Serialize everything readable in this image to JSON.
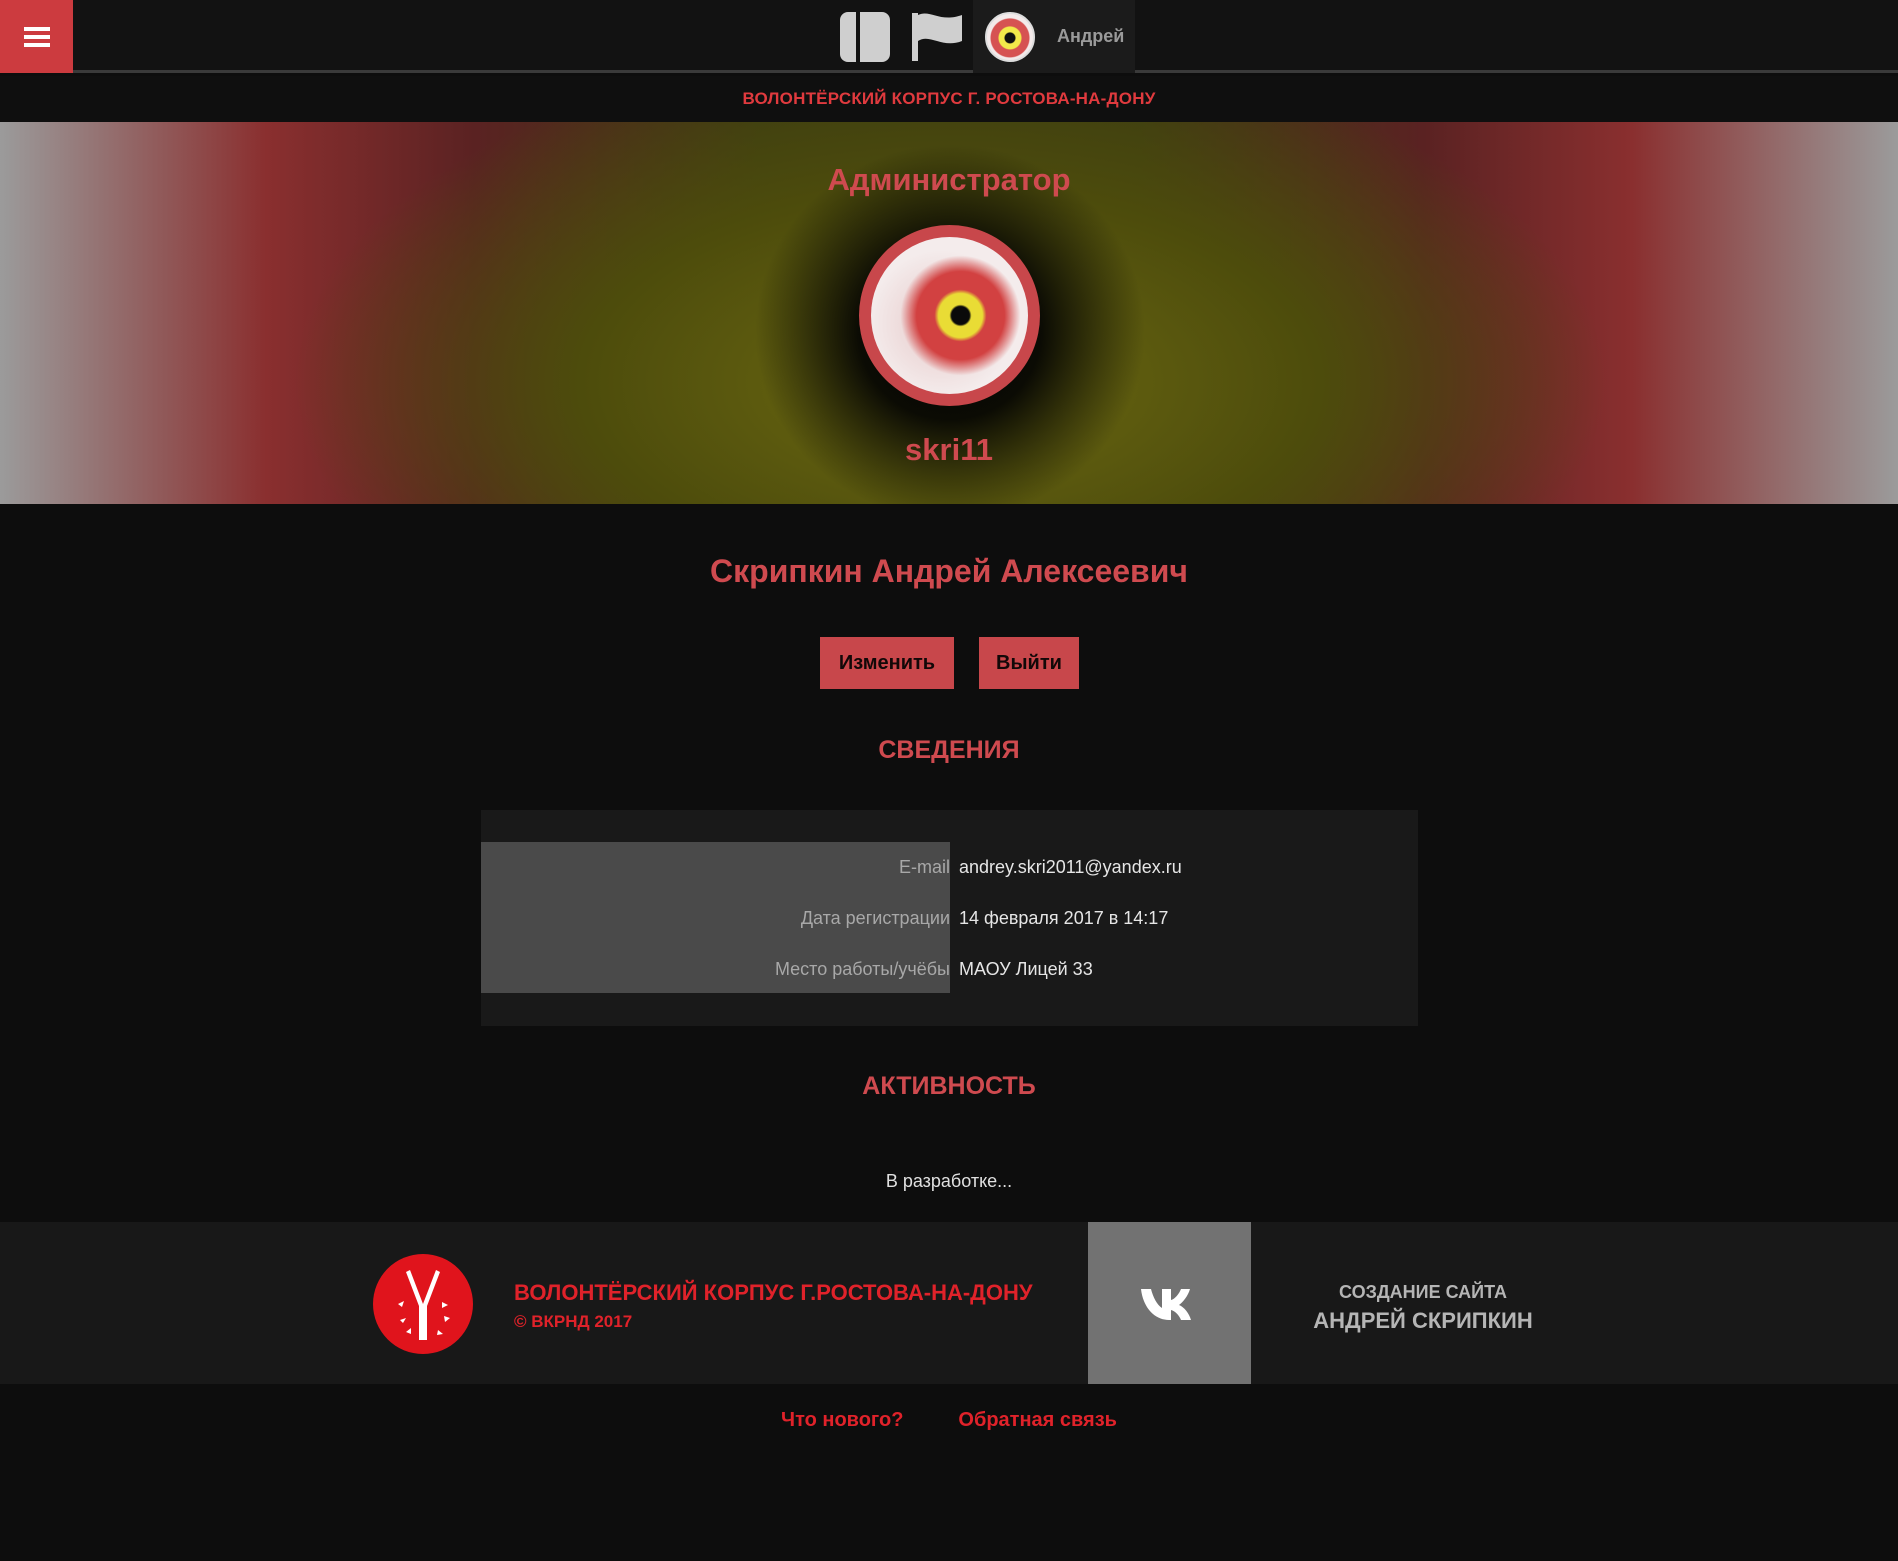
{
  "header": {
    "menu_icon": "hamburger-icon",
    "nav_icons": [
      "layout-icon",
      "flag-icon"
    ],
    "user_name": "Андрей",
    "accent_color": "#cc3b3f"
  },
  "org_bar": {
    "title": "ВОЛОНТЁРСКИЙ КОРПУС Г. РОСТОВА-НА-ДОНУ"
  },
  "profile": {
    "role": "Администратор",
    "login": "skri11",
    "full_name": "Скрипкин Андрей Алексеевич",
    "edit_label": "Изменить",
    "logout_label": "Выйти"
  },
  "info": {
    "title": "СВЕДЕНИЯ",
    "rows": [
      {
        "label": "E-mail",
        "value": "andrey.skri2011@yandex.ru"
      },
      {
        "label": "Дата регистрации",
        "value": "14 февраля 2017 в 14:17"
      },
      {
        "label": "Место работы/учёбы",
        "value": "МАОУ Лицей 33"
      }
    ]
  },
  "activity": {
    "title": "АКТИВНОСТЬ",
    "note": "В разработке..."
  },
  "footer": {
    "org_name": "ВОЛОНТЁРСКИЙ КОРПУС   Г.РОСТОВА-НА-ДОНУ",
    "copyright": "© ВКРНД 2017",
    "vk_icon": "vk-icon",
    "credit_title": "СОЗДАНИЕ САЙТА",
    "credit_name": "АНДРЕЙ СКРИПКИН"
  },
  "bottom_links": {
    "whats_new": "Что нового?",
    "feedback": "Обратная связь"
  }
}
